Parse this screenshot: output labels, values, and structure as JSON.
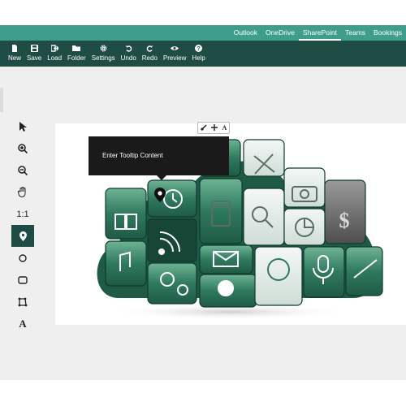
{
  "topnav": {
    "links": [
      "Outlook",
      "OneDrive",
      "SharePoint",
      "Teams",
      "Bookings"
    ],
    "active": "SharePoint"
  },
  "toolbar": {
    "buttons": [
      {
        "label": "New",
        "icon": "file-icon"
      },
      {
        "label": "Save",
        "icon": "save-icon"
      },
      {
        "label": "Load",
        "icon": "load-icon"
      },
      {
        "label": "Folder",
        "icon": "folder-icon"
      },
      {
        "label": "Settings",
        "icon": "gear-icon"
      },
      {
        "label": "Undo",
        "icon": "undo-icon"
      },
      {
        "label": "Redo",
        "icon": "redo-icon"
      },
      {
        "label": "Preview",
        "icon": "eye-icon"
      },
      {
        "label": "Help",
        "icon": "help-icon"
      }
    ]
  },
  "palette": {
    "tools": [
      {
        "name": "select-tool",
        "icon": "cursor-icon"
      },
      {
        "name": "zoom-in-tool",
        "icon": "zoom-in-icon"
      },
      {
        "name": "zoom-out-tool",
        "icon": "zoom-out-icon"
      },
      {
        "name": "pan-tool",
        "icon": "hand-icon"
      },
      {
        "name": "actual-size-tool",
        "label": "1:1"
      },
      {
        "name": "marker-tool",
        "icon": "pin-icon",
        "active": true
      },
      {
        "name": "circle-tool",
        "icon": "circle-icon"
      },
      {
        "name": "rectangle-tool",
        "icon": "rectangle-icon"
      },
      {
        "name": "polygon-tool",
        "icon": "polygon-icon"
      },
      {
        "name": "text-tool",
        "label": "A"
      }
    ]
  },
  "minibar": {
    "items": [
      "brush-icon",
      "move-icon",
      "text-icon"
    ],
    "text_label": "A"
  },
  "tooltip": {
    "text": "Enter Tooltip Content"
  },
  "colors": {
    "nav": "#3e9d8b",
    "toolbar": "#1f4c45",
    "active_tool": "#1f4c45",
    "workarea": "#efefef",
    "tile_green": "#2f7a5f",
    "tile_dark": "#174536",
    "tile_grey": "#6d6d6d",
    "tile_light": "#e8efec"
  }
}
